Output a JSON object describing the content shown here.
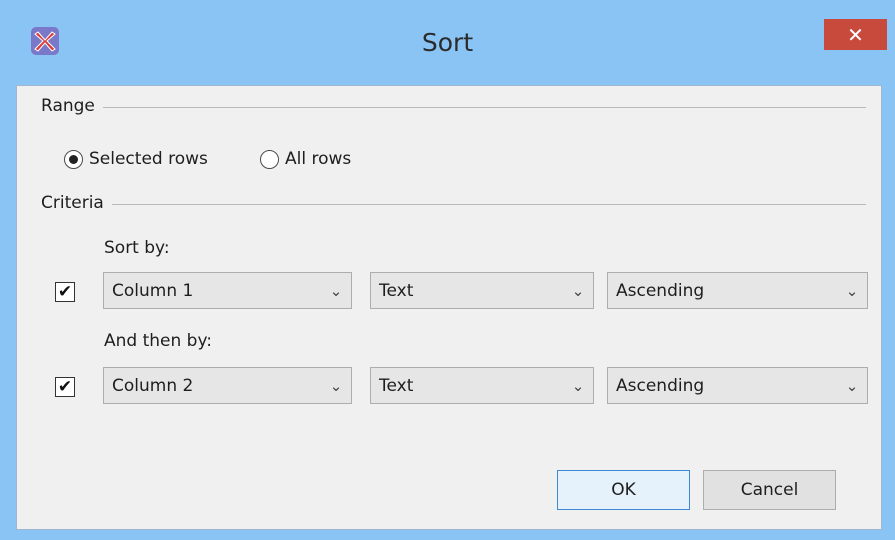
{
  "window": {
    "title": "Sort",
    "close_label": "✕"
  },
  "range": {
    "label": "Range",
    "selected_rows_label": "Selected rows",
    "all_rows_label": "All rows",
    "selected_option": "Selected rows"
  },
  "criteria": {
    "label": "Criteria",
    "sort_by_label": "Sort by:",
    "then_by_label": "And then by:",
    "rows": [
      {
        "checked": true,
        "column": "Column 1",
        "type": "Text",
        "order": "Ascending"
      },
      {
        "checked": true,
        "column": "Column 2",
        "type": "Text",
        "order": "Ascending"
      }
    ]
  },
  "buttons": {
    "ok": "OK",
    "cancel": "Cancel"
  },
  "icons": {
    "app": "app-logo-icon",
    "dropdown": "chevron-down-icon",
    "check": "checkmark-icon",
    "close": "close-icon"
  },
  "colors": {
    "titlebar": "#8ac4f5",
    "close": "#c74a3d",
    "client": "#f0f0f0"
  }
}
